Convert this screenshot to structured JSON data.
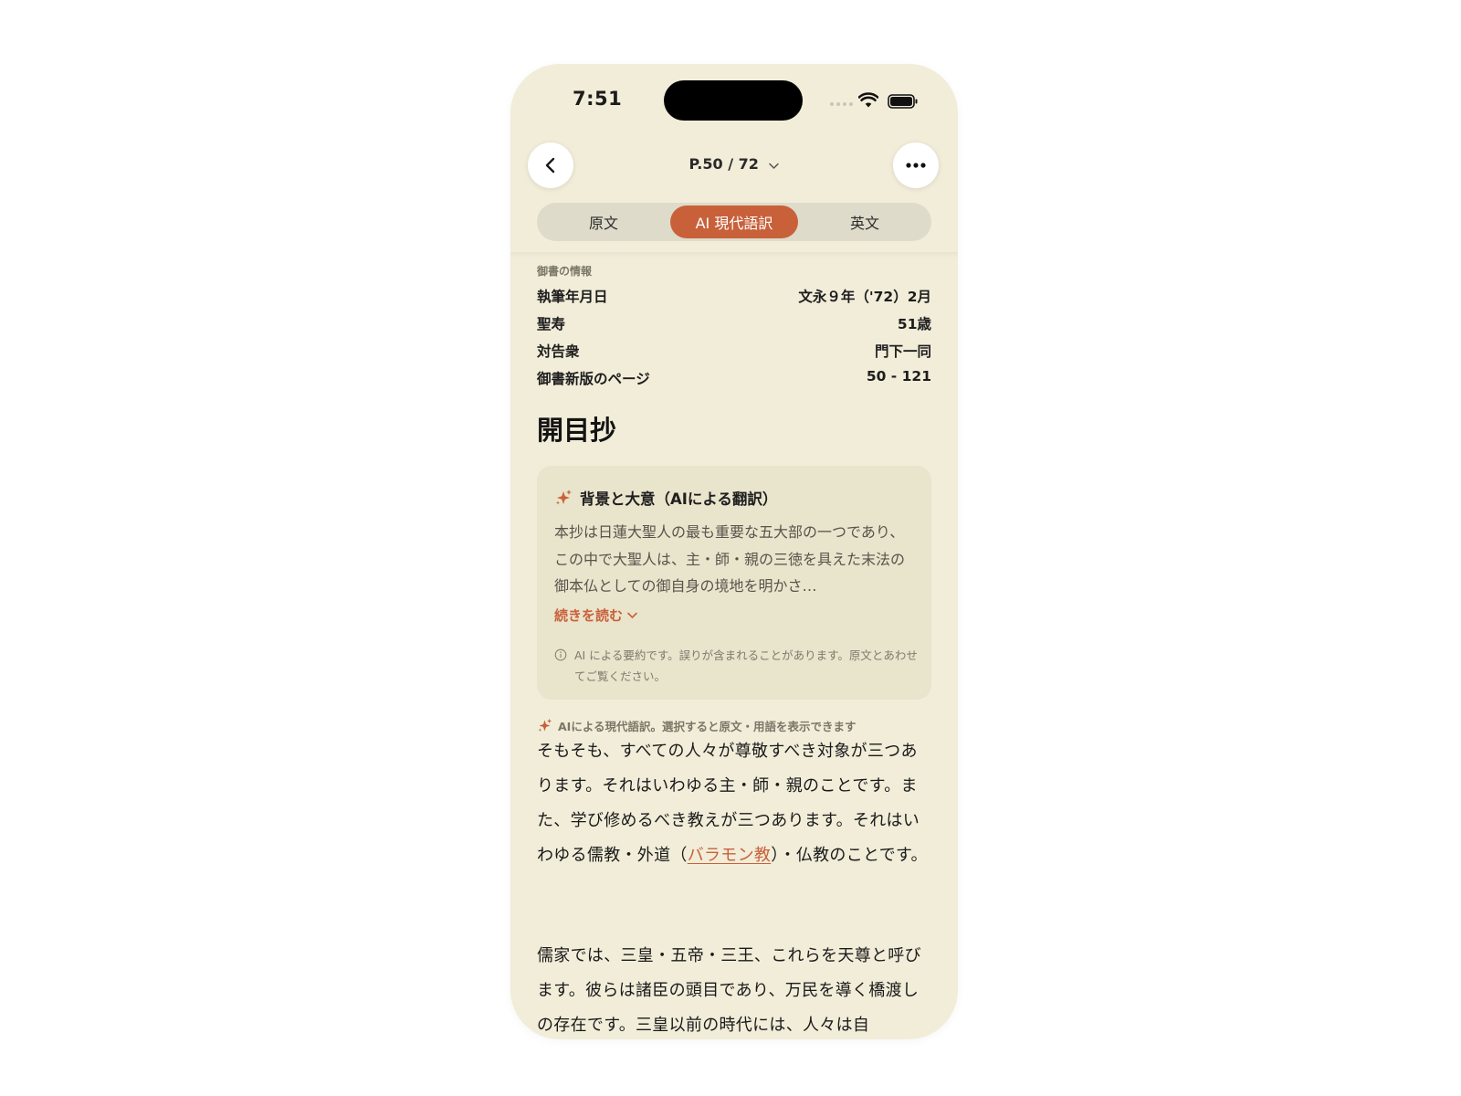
{
  "status_bar": {
    "time": "7:51"
  },
  "nav": {
    "page_indicator": "P.50 / 72"
  },
  "tabs": [
    {
      "label": "原文",
      "active": false
    },
    {
      "label": "AI 現代語訳",
      "active": true
    },
    {
      "label": "英文",
      "active": false
    }
  ],
  "info": {
    "caption": "御書の情報",
    "rows": [
      {
        "label": "執筆年月日",
        "value": "文永９年（'72）2月"
      },
      {
        "label": "聖寿",
        "value": "51歳"
      },
      {
        "label": "対告衆",
        "value": "門下一同"
      },
      {
        "label": "御書新版のページ",
        "value": "50 - 121"
      }
    ]
  },
  "title": "開目抄",
  "summary_card": {
    "title": "背景と大意（AIによる翻訳）",
    "body": "本抄は日蓮大聖人の最も重要な五大部の一つであり、この中で大聖人は、主・師・親の三徳を具えた末法の御本仏としての御自身の境地を明かさ…",
    "read_more": "続きを読む",
    "disclaimer": "AI による要約です。誤りが含まれることがあります。原文とあわせてご覧ください。"
  },
  "translation_hint": "AIによる現代語訳。選択すると原文・用語を表示できます",
  "paragraph1": {
    "before": "そもそも、すべての人々が尊敬すべき対象が三つあります。それはいわゆる主・師・親のことです。また、学び修めるべき教えが三つあります。それはいわゆる儒教・外道（",
    "term": "バラモン教",
    "after": "）・仏教のことです。"
  },
  "paragraph2": "儒家では、三皇・五帝・三王、これらを天尊と呼びます。彼らは諸臣の頭目であり、万民を導く橋渡しの存在です。三皇以前の時代には、人々は自",
  "colors": {
    "background": "#f1edd9",
    "accent": "#c8613a",
    "card": "#e9e4cc",
    "segment": "#dedbca"
  }
}
